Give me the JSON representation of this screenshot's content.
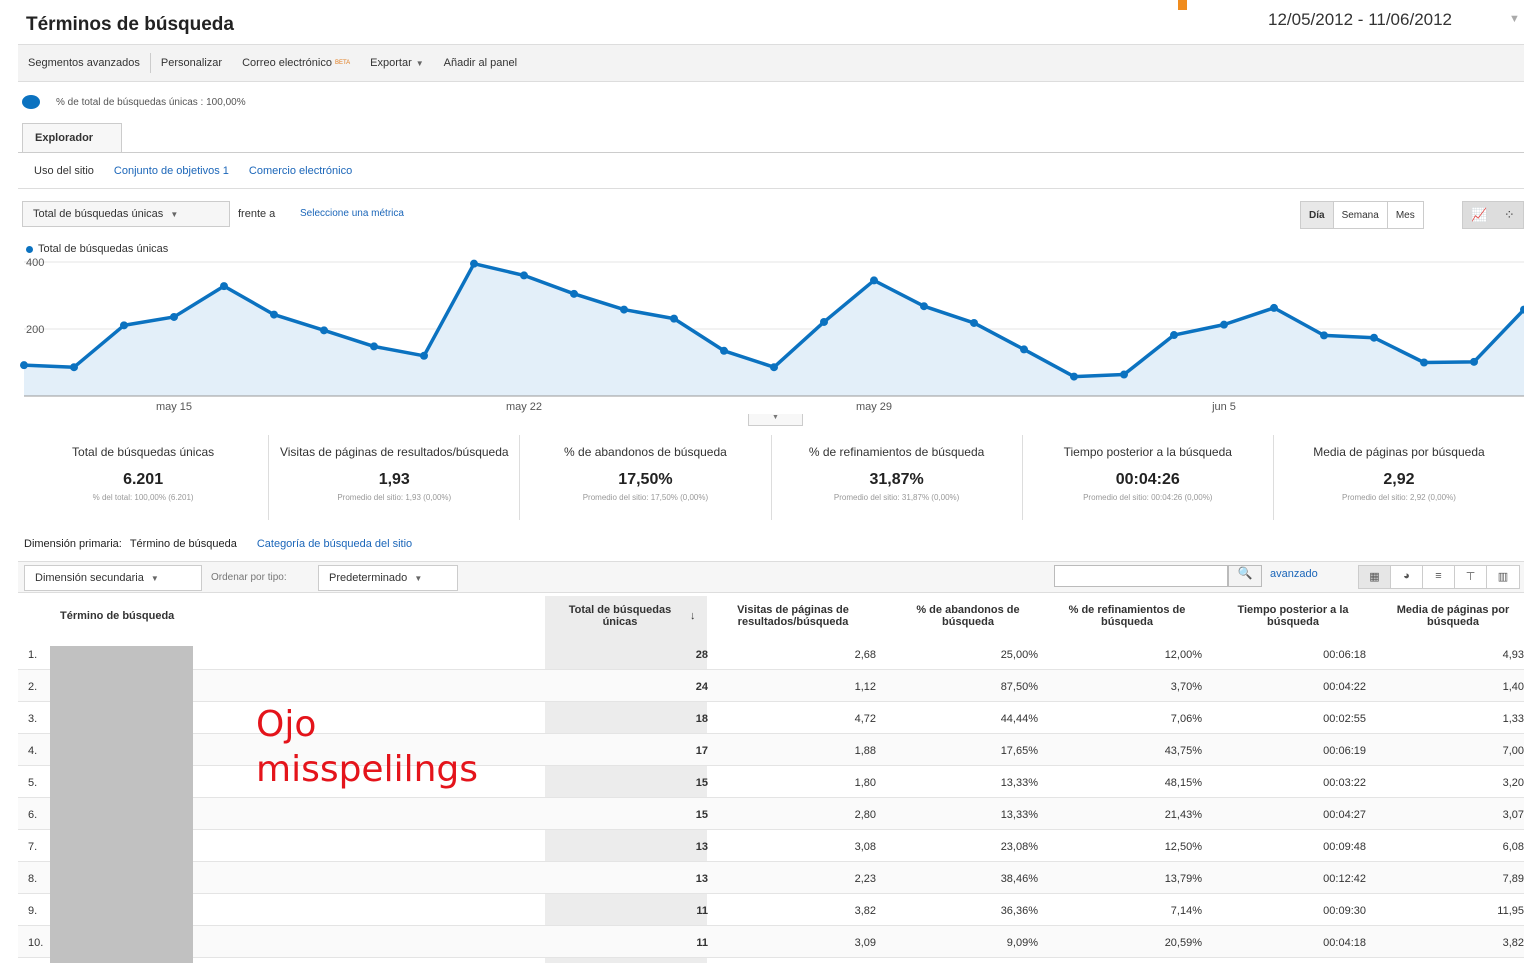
{
  "header": {
    "title": "Términos de búsqueda",
    "date_range": "12/05/2012 - 11/06/2012"
  },
  "toolbar": {
    "advanced_segments": "Segmentos avanzados",
    "customize": "Personalizar",
    "email": "Correo electrónico",
    "beta": "BETA",
    "export": "Exportar",
    "add_dashboard": "Añadir al panel"
  },
  "segment": {
    "text": "% de total de búsquedas únicas : 100,00%"
  },
  "tabs": {
    "explorer": "Explorador",
    "subtabs": [
      "Uso del sitio",
      "Conjunto de objetivos 1",
      "Comercio electrónico"
    ]
  },
  "chart_controls": {
    "metric": "Total de búsquedas únicas",
    "versus": "frente a",
    "select_metric": "Seleccione una métrica",
    "periods": [
      "Día",
      "Semana",
      "Mes"
    ],
    "selected_period": "Día"
  },
  "chart_data": {
    "type": "area",
    "series": [
      {
        "name": "Total de búsquedas únicas",
        "values": [
          92,
          86,
          211,
          236,
          328,
          243,
          196,
          148,
          120,
          395,
          360,
          305,
          258,
          231,
          135,
          86,
          221,
          345,
          268,
          218,
          139,
          58,
          64,
          182,
          213,
          263,
          181,
          174,
          100,
          102,
          258
        ]
      }
    ],
    "x_tick_labels": [
      "may 15",
      "may 22",
      "may 29",
      "jun 5"
    ],
    "x_tick_indices": [
      3,
      10,
      17,
      24
    ],
    "y_ticks": [
      200,
      400
    ],
    "ylim": [
      0,
      400
    ],
    "color": "#0b72c0",
    "fill": "#e3eff9",
    "grid": true
  },
  "metrics": [
    {
      "label": "Total de búsquedas únicas",
      "value": "6.201",
      "avg": "% del total: 100,00% (6.201)"
    },
    {
      "label": "Visitas de páginas de resultados/búsqueda",
      "value": "1,93",
      "avg": "Promedio del sitio: 1,93 (0,00%)"
    },
    {
      "label": "% de abandonos de búsqueda",
      "value": "17,50%",
      "avg": "Promedio del sitio: 17,50% (0,00%)"
    },
    {
      "label": "% de refinamientos de búsqueda",
      "value": "31,87%",
      "avg": "Promedio del sitio: 31,87% (0,00%)"
    },
    {
      "label": "Tiempo posterior a la búsqueda",
      "value": "00:04:26",
      "avg": "Promedio del sitio: 00:04:26 (0,00%)"
    },
    {
      "label": "Media de páginas por búsqueda",
      "value": "2,92",
      "avg": "Promedio del sitio: 2,92 (0,00%)"
    }
  ],
  "dimension": {
    "label": "Dimensión primaria:",
    "primary": "Término de búsqueda",
    "alternate": "Categoría de búsqueda del sitio"
  },
  "table_controls": {
    "secondary_dimension": "Dimensión secundaria",
    "sort_label": "Ordenar por tipo:",
    "sort_value": "Predeterminado",
    "advanced": "avanzado"
  },
  "table": {
    "headers": [
      "Término de búsqueda",
      "Total de búsquedas únicas",
      "Visitas de páginas de resultados/búsqueda",
      "% de abandonos de búsqueda",
      "% de refinamientos de búsqueda",
      "Tiempo posterior a la búsqueda",
      "Media de páginas por búsqueda"
    ],
    "rows": [
      {
        "n": "1.",
        "total": "28",
        "visits": "2,68",
        "aband": "25,00%",
        "refin": "12,00%",
        "time": "00:06:18",
        "pages": "4,93"
      },
      {
        "n": "2.",
        "total": "24",
        "visits": "1,12",
        "aband": "87,50%",
        "refin": "3,70%",
        "time": "00:04:22",
        "pages": "1,40"
      },
      {
        "n": "3.",
        "total": "18",
        "visits": "4,72",
        "aband": "44,44%",
        "refin": "7,06%",
        "time": "00:02:55",
        "pages": "1,33"
      },
      {
        "n": "4.",
        "total": "17",
        "visits": "1,88",
        "aband": "17,65%",
        "refin": "43,75%",
        "time": "00:06:19",
        "pages": "7,00"
      },
      {
        "n": "5.",
        "total": "15",
        "visits": "1,80",
        "aband": "13,33%",
        "refin": "48,15%",
        "time": "00:03:22",
        "pages": "3,20"
      },
      {
        "n": "6.",
        "total": "15",
        "visits": "2,80",
        "aband": "13,33%",
        "refin": "21,43%",
        "time": "00:04:27",
        "pages": "3,07"
      },
      {
        "n": "7.",
        "total": "13",
        "visits": "3,08",
        "aband": "23,08%",
        "refin": "12,50%",
        "time": "00:09:48",
        "pages": "6,08"
      },
      {
        "n": "8.",
        "total": "13",
        "visits": "2,23",
        "aband": "38,46%",
        "refin": "13,79%",
        "time": "00:12:42",
        "pages": "7,89"
      },
      {
        "n": "9.",
        "total": "11",
        "visits": "3,82",
        "aband": "36,36%",
        "refin": "7,14%",
        "time": "00:09:30",
        "pages": "11,95"
      },
      {
        "n": "10.",
        "total": "11",
        "visits": "3,09",
        "aband": "9,09%",
        "refin": "20,59%",
        "time": "00:04:18",
        "pages": "3,82"
      }
    ]
  },
  "annotation": {
    "line1": "Ojo",
    "line2": "misspelilngs"
  },
  "icons": {
    "segment": "pie-icon",
    "search": "search-icon",
    "sort": "sort-desc-icon",
    "chart_line": "line-chart-icon",
    "chart_motion": "motion-chart-icon",
    "view_table": "table-view-icon",
    "view_pie": "pie-view-icon",
    "view_bar": "bar-view-icon",
    "view_compare": "compare-view-icon",
    "view_pivot": "pivot-view-icon"
  }
}
